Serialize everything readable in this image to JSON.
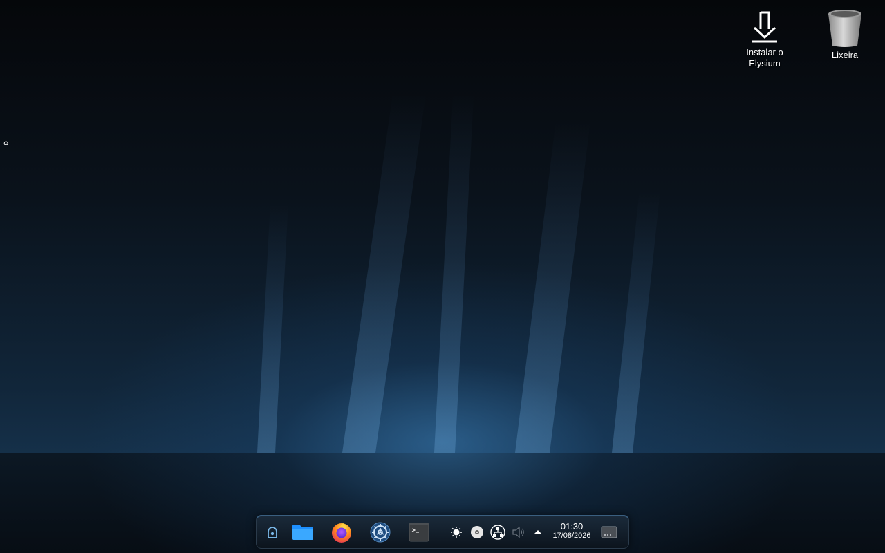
{
  "desktop": {
    "icons": [
      {
        "label": "Instalar o Elysium",
        "icon": "install-download-icon"
      },
      {
        "label": "Lixeira",
        "icon": "trash-bin-icon"
      }
    ],
    "left_glyph": "ɷ"
  },
  "colors": {
    "accent": "#3aa0ff",
    "panel": "#111c27",
    "folder": "#1e90ff"
  },
  "panel": {
    "launchers": [
      {
        "name": "app-launcher",
        "icon": "launcher-icon"
      },
      {
        "name": "files",
        "icon": "folder-icon"
      },
      {
        "name": "firefox",
        "icon": "firefox-icon"
      },
      {
        "name": "settings",
        "icon": "settings-gear-icon"
      },
      {
        "name": "terminal",
        "icon": "terminal-icon"
      }
    ],
    "tray": [
      {
        "name": "brightness",
        "icon": "brightness-icon"
      },
      {
        "name": "disc",
        "icon": "disc-icon"
      },
      {
        "name": "network",
        "icon": "network-icon"
      },
      {
        "name": "volume",
        "icon": "volume-muted-icon"
      },
      {
        "name": "expand",
        "icon": "caret-up-icon"
      }
    ],
    "clock": {
      "time": "01:30",
      "date": "17/08/2026"
    }
  }
}
